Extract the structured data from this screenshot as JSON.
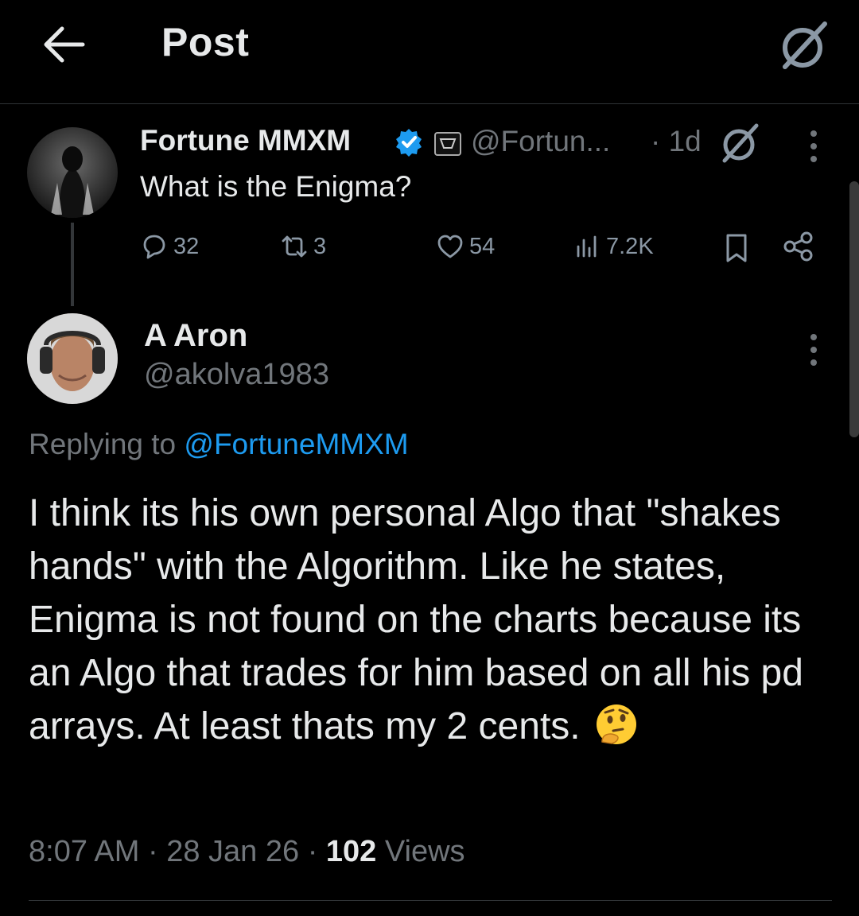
{
  "header": {
    "title": "Post"
  },
  "parent_tweet": {
    "author_name": "Fortune MMXM",
    "handle": "@Fortun...",
    "time": "· 1d",
    "text": "What is the Enigma?",
    "stats": {
      "replies": "32",
      "reposts": "3",
      "likes": "54",
      "views": "7.2K"
    }
  },
  "reply_tweet": {
    "author_name": "A Aron",
    "handle": "@akolva1983",
    "replying_prefix": "Replying to ",
    "replying_handle": "@FortuneMMXM",
    "text": "I think its his own personal Algo that \"shakes hands\" with the Algorithm. Like he states, Enigma is not found on the charts because its an Algo that trades for him based on all his pd arrays. At least thats my 2 cents.",
    "emoji": "thinking-face",
    "time": "8:07 AM",
    "date": "28 Jan 26",
    "views_count": "102",
    "views_label": "Views"
  },
  "colors": {
    "accent": "#1d9bf0",
    "background": "#000000",
    "muted": "#71767b",
    "text": "#e7e9ea"
  }
}
